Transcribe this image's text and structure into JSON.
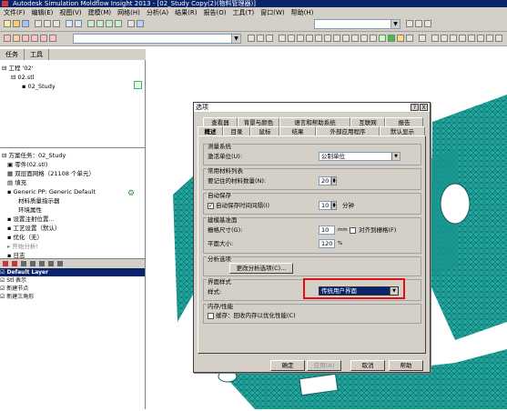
{
  "window": {
    "title": "Autodesk Simulation Moldflow Insight 2013 - [02_Study Copy(2)(物料管理器)]"
  },
  "menu": [
    "文件(F)",
    "编辑(E)",
    "视图(V)",
    "建模(M)",
    "网格(H)",
    "分析(A)",
    "结果(R)",
    "报告(O)",
    "工具(T)",
    "窗口(W)",
    "帮助(H)"
  ],
  "toolbar": {
    "combo1": "",
    "combo2": ""
  },
  "left_tabs": [
    "任务",
    "工具"
  ],
  "project_tree": [
    "工程 '02'",
    "02.stl",
    "02_Study"
  ],
  "task_tree": {
    "title": "方案任务：02_Study",
    "items": [
      "零件(02.stl)",
      "双层面网格（21108 个单元）",
      "填充",
      "Generic PP: Generic Default",
      "材料质量指示器",
      "环境属性",
      "设置注射位置...",
      "工艺设置（默认）",
      "优化（无）",
      "开始分析!",
      "日志"
    ]
  },
  "layers": {
    "items": [
      "Default Layer",
      "Stl 表示",
      "新建节点",
      "新建三角形"
    ]
  },
  "dialog": {
    "title": "选项",
    "help": "?",
    "close": "X",
    "tabs_row1": [
      "查看器",
      "背景与颜色",
      "语言和帮助系统",
      "互联网",
      "报告"
    ],
    "tabs_row2": [
      "概述",
      "目录",
      "鼠标",
      "结果",
      "外部应用程序",
      "默认显示"
    ],
    "measure": {
      "legend": "测量系统",
      "label": "激活单位(U):",
      "value": "公制单位"
    },
    "materials": {
      "legend": "常用材料列表",
      "label": "要记住的材料数量(N):",
      "value": "20"
    },
    "autosave": {
      "legend": "自动保存",
      "checkbox": "自动保存时间间隔(I)",
      "checked": true,
      "value": "10",
      "unit": "分钟"
    },
    "modeling": {
      "legend": "建模基准面",
      "grid_label": "栅格尺寸(G):",
      "grid_value": "10",
      "grid_unit": "mm",
      "snap_label": "对齐到栅格(F)",
      "plane_label": "平面大小:",
      "plane_value": "120",
      "plane_unit": "%"
    },
    "analysis": {
      "legend": "分析选项",
      "button": "更改分析选项(C)..."
    },
    "ui": {
      "legend": "界面样式",
      "label": "样式:",
      "value": "传统用户界面"
    },
    "memory": {
      "legend": "内存/性能",
      "checkbox": "缓存：回收内存以优化性能(C)"
    },
    "buttons": {
      "ok": "确定",
      "apply": "应用(A)",
      "cancel": "取消",
      "help": "帮助"
    }
  },
  "colors": {
    "dialog_bg": "#d4d0c8",
    "highlight": "#0a246a",
    "mesh": "#20a8a0",
    "redbox": "#e01010"
  }
}
